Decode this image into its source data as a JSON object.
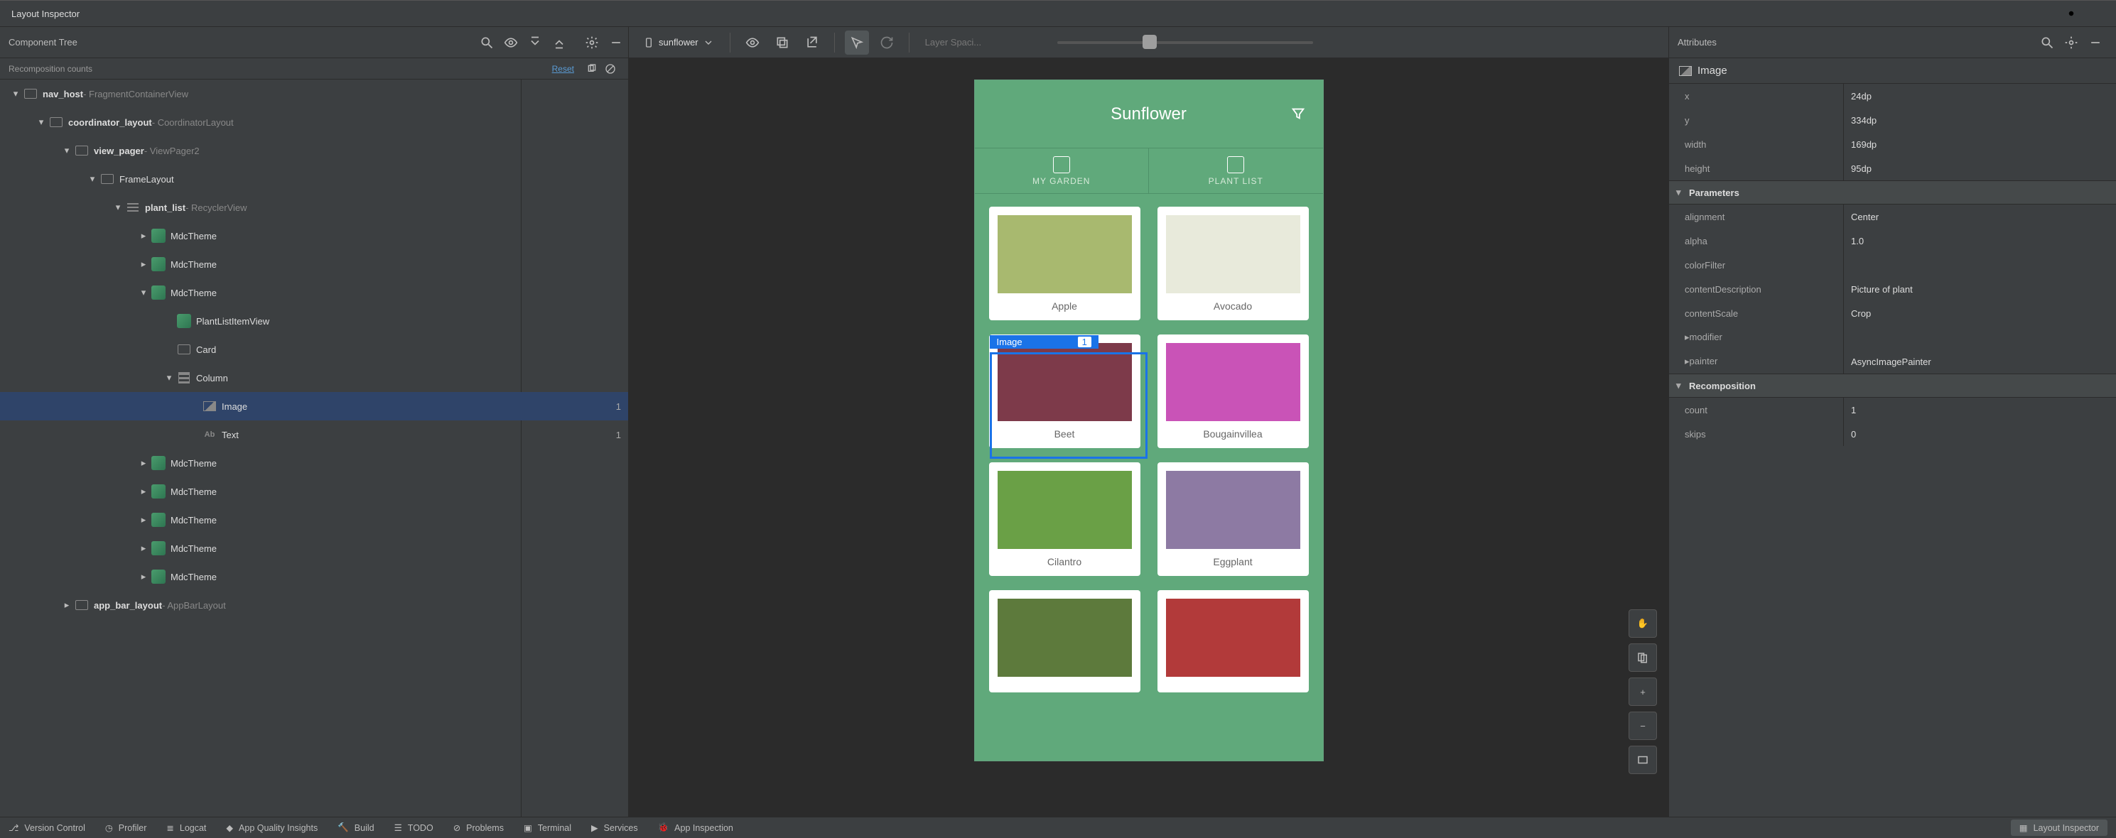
{
  "title": "Layout Inspector",
  "tree": {
    "panel_title": "Component Tree",
    "counts_header": "Recomposition counts",
    "reset": "Reset"
  },
  "device_name": "sunflower",
  "layer_label": "Layer Spaci...",
  "attributes_title": "Attributes",
  "selected_node": "Image",
  "tree_nodes": [
    {
      "indent": 0,
      "arrow": "▾",
      "icon": "box",
      "label": "nav_host",
      "type": " - FragmentContainerView",
      "bold": true
    },
    {
      "indent": 1,
      "arrow": "▾",
      "icon": "box",
      "label": "coordinator_layout",
      "type": " - CoordinatorLayout",
      "bold": true
    },
    {
      "indent": 2,
      "arrow": "▾",
      "icon": "box",
      "label": "view_pager",
      "type": " - ViewPager2",
      "bold": true
    },
    {
      "indent": 3,
      "arrow": "▾",
      "icon": "box",
      "label": "FrameLayout",
      "type": ""
    },
    {
      "indent": 4,
      "arrow": "▾",
      "icon": "list",
      "label": "plant_list",
      "type": " - RecyclerView",
      "bold": true
    },
    {
      "indent": 5,
      "arrow": "▸",
      "icon": "compose",
      "label": "MdcTheme",
      "type": ""
    },
    {
      "indent": 5,
      "arrow": "▸",
      "icon": "compose",
      "label": "MdcTheme",
      "type": ""
    },
    {
      "indent": 5,
      "arrow": "▾",
      "icon": "compose",
      "label": "MdcTheme",
      "type": ""
    },
    {
      "indent": 6,
      "arrow": " ",
      "icon": "compose",
      "label": "PlantListItemView",
      "type": ""
    },
    {
      "indent": 6,
      "arrow": " ",
      "icon": "box",
      "label": "Card",
      "type": ""
    },
    {
      "indent": 6,
      "arrow": "▾",
      "icon": "col",
      "label": "Column",
      "type": ""
    },
    {
      "indent": 7,
      "arrow": " ",
      "icon": "img",
      "label": "Image",
      "type": "",
      "selected": true,
      "count": "1"
    },
    {
      "indent": 7,
      "arrow": " ",
      "icon": "txt",
      "label": "Text",
      "type": "",
      "count": "1"
    },
    {
      "indent": 5,
      "arrow": "▸",
      "icon": "compose",
      "label": "MdcTheme",
      "type": ""
    },
    {
      "indent": 5,
      "arrow": "▸",
      "icon": "compose",
      "label": "MdcTheme",
      "type": ""
    },
    {
      "indent": 5,
      "arrow": "▸",
      "icon": "compose",
      "label": "MdcTheme",
      "type": ""
    },
    {
      "indent": 5,
      "arrow": "▸",
      "icon": "compose",
      "label": "MdcTheme",
      "type": ""
    },
    {
      "indent": 5,
      "arrow": "▸",
      "icon": "compose",
      "label": "MdcTheme",
      "type": ""
    },
    {
      "indent": 2,
      "arrow": "▸",
      "icon": "box",
      "label": "app_bar_layout",
      "type": " - AppBarLayout",
      "bold": true
    }
  ],
  "preview": {
    "title": "Sunflower",
    "tabs": [
      "MY GARDEN",
      "PLANT LIST"
    ],
    "plants": [
      "Apple",
      "Avocado",
      "Beet",
      "Bougainvillea",
      "Cilantro",
      "Eggplant",
      "",
      ""
    ],
    "sel_label": "Image",
    "sel_count": "1"
  },
  "attrs": {
    "basic": [
      {
        "k": "x",
        "v": "24dp"
      },
      {
        "k": "y",
        "v": "334dp"
      },
      {
        "k": "width",
        "v": "169dp"
      },
      {
        "k": "height",
        "v": "95dp"
      }
    ],
    "sections": [
      {
        "title": "Parameters",
        "rows": [
          {
            "k": "alignment",
            "v": "Center"
          },
          {
            "k": "alpha",
            "v": "1.0"
          },
          {
            "k": "colorFilter",
            "v": ""
          },
          {
            "k": "contentDescription",
            "v": "Picture of plant"
          },
          {
            "k": "contentScale",
            "v": "Crop"
          },
          {
            "k": "modifier",
            "v": "",
            "chev": "▸"
          },
          {
            "k": "painter",
            "v": "AsyncImagePainter",
            "chev": "▸"
          }
        ]
      },
      {
        "title": "Recomposition",
        "rows": [
          {
            "k": "count",
            "v": "1"
          },
          {
            "k": "skips",
            "v": "0"
          }
        ]
      }
    ]
  },
  "bottom": [
    "Version Control",
    "Profiler",
    "Logcat",
    "App Quality Insights",
    "Build",
    "TODO",
    "Problems",
    "Terminal",
    "Services",
    "App Inspection"
  ],
  "bottom_active": "Layout Inspector"
}
